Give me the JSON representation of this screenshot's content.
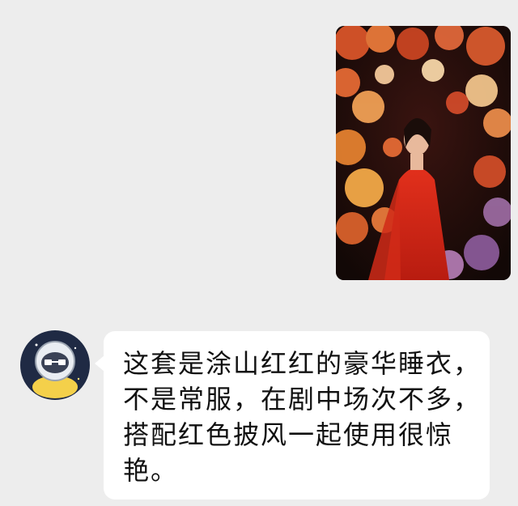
{
  "messages": [
    {
      "direction": "outgoing",
      "kind": "image",
      "image_icon": "photo-woman-red-dress-flowers"
    },
    {
      "direction": "incoming",
      "kind": "text",
      "avatar_icon": "astronaut-cartoon-avatar",
      "lines": [
        "这套是涂山红红的豪华睡衣，",
        "不是常服，在剧中场次不多，",
        "搭配红色披风一起使用很惊",
        "艳。"
      ]
    }
  ],
  "colors": {
    "background": "#ededed",
    "bubble": "#ffffff",
    "text": "#111111"
  }
}
